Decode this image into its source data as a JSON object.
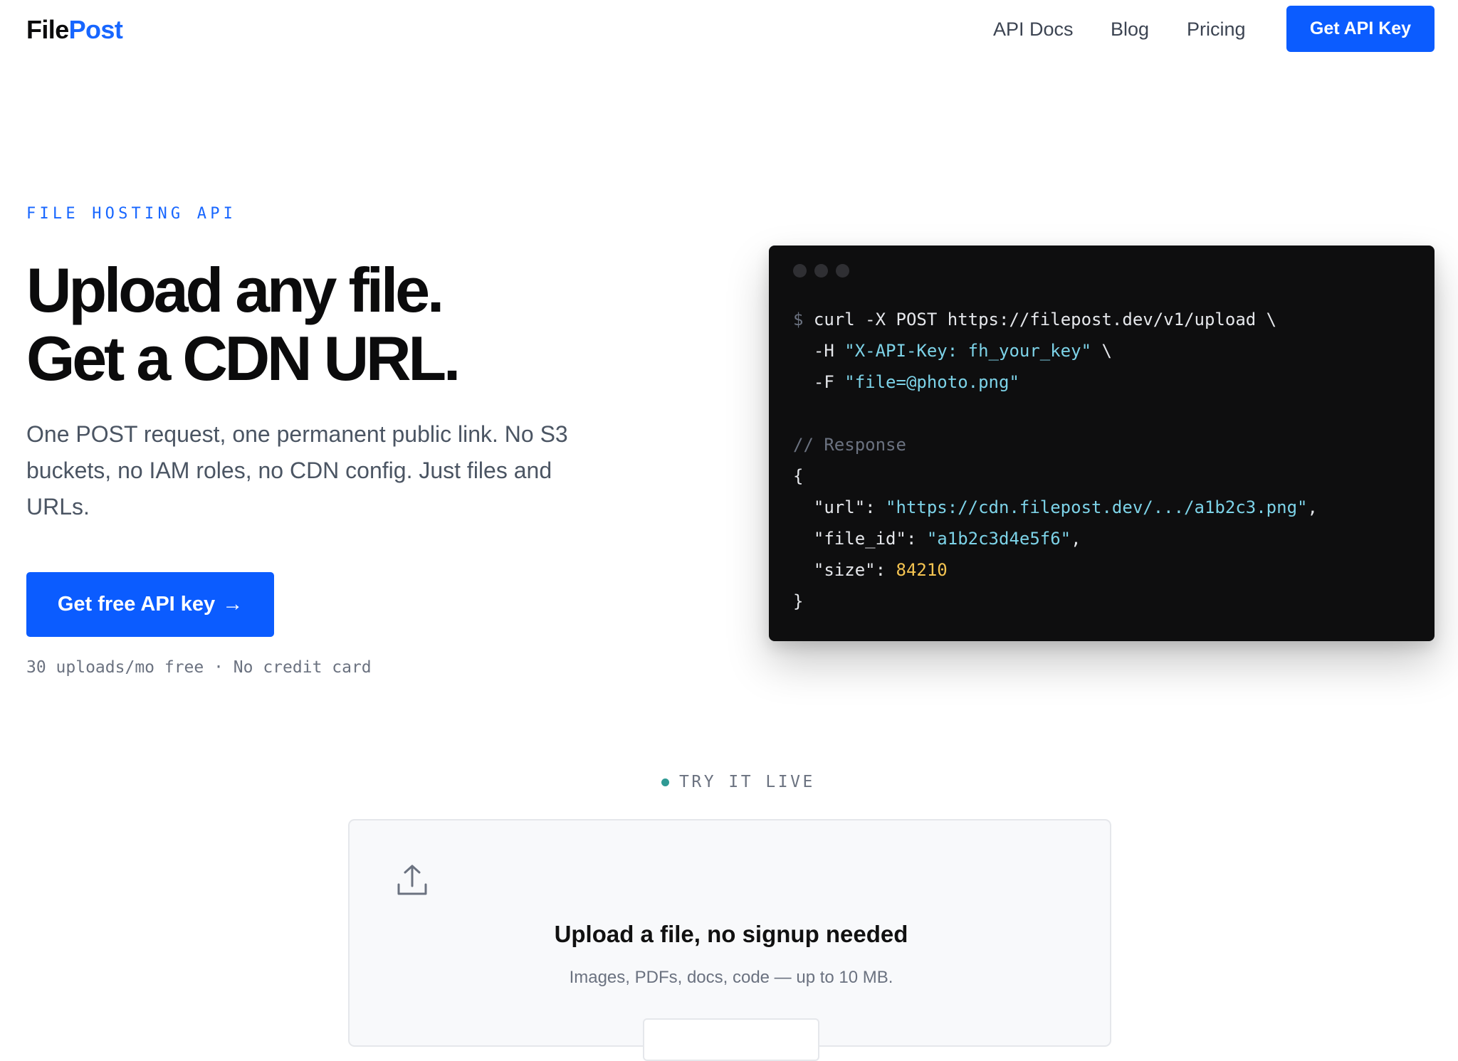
{
  "header": {
    "logo_part1": "File",
    "logo_part2": "Post",
    "nav": {
      "docs": "API Docs",
      "blog": "Blog",
      "pricing": "Pricing"
    },
    "cta_label": "Get API Key"
  },
  "hero": {
    "eyebrow": "FILE HOSTING API",
    "title_line1": "Upload any file.",
    "title_line2": "Get a CDN URL.",
    "subtitle": "One POST request, one permanent public link. No S3 buckets, no IAM roles, no CDN config. Just files and URLs.",
    "cta_label": "Get free API key",
    "cta_arrow": "→",
    "note": "30 uploads/mo free · No credit card"
  },
  "code": {
    "prompt": "$",
    "cmd_line1": "curl -X POST https://filepost.dev/v1/upload \\",
    "h_flag": "  -H ",
    "h_value": "\"X-API-Key: fh_your_key\"",
    "h_cont": " \\",
    "f_flag": "  -F ",
    "f_value": "\"file=@photo.png\"",
    "comment": "// Response",
    "brace_open": "{",
    "url_key": "  \"url\": ",
    "url_value": "\"https://cdn.filepost.dev/.../a1b2c3.png\"",
    "file_id_key": "  \"file_id\": ",
    "file_id_value": "\"a1b2c3d4e5f6\"",
    "size_key": "  \"size\": ",
    "size_value": "84210",
    "comma": ",",
    "brace_close": "}"
  },
  "try_live": {
    "label": "TRY IT LIVE",
    "title": "Upload a file, no signup needed",
    "subtitle": "Images, PDFs, docs, code — up to 10 MB."
  },
  "colors": {
    "accent": "#0b5cff",
    "brand_blue": "#1766ff",
    "code_bg": "#0e0e0f",
    "code_string": "#7dd3e8",
    "code_number": "#f5c451",
    "live_dot": "#2f9a94"
  },
  "icons": {
    "window_dots": "window-dot-icon",
    "upload": "upload-icon",
    "live_indicator": "live-dot-icon"
  }
}
